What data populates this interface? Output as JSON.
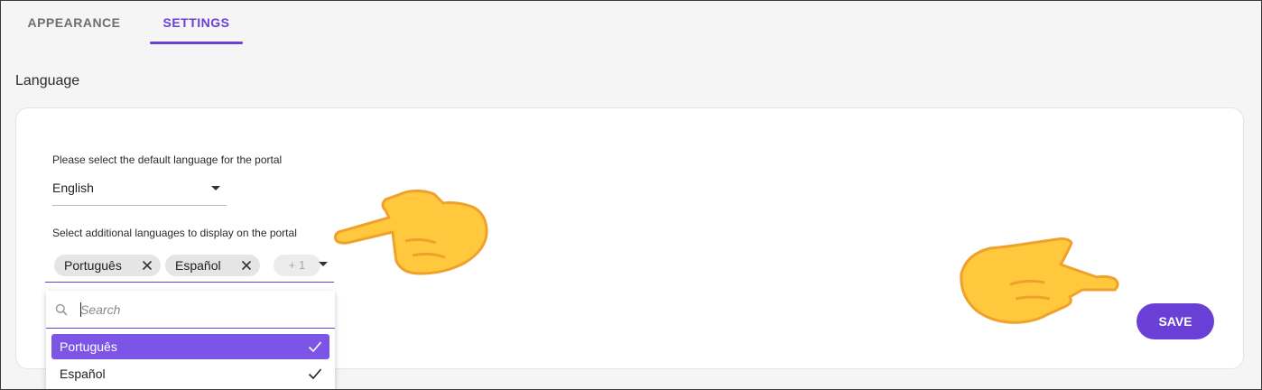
{
  "tabs": [
    {
      "label": "APPEARANCE",
      "active": false
    },
    {
      "label": "SETTINGS",
      "active": true
    }
  ],
  "section": {
    "title": "Language"
  },
  "default_language": {
    "label": "Please select the default language for the portal",
    "value": "English"
  },
  "additional_languages": {
    "label": "Select additional languages to display on the portal",
    "chips": [
      "Português",
      "Español"
    ],
    "more_count": "+ 1"
  },
  "dropdown": {
    "search_placeholder": "Search",
    "options": [
      {
        "label": "Português",
        "selected": true,
        "highlighted": true
      },
      {
        "label": "Español",
        "selected": true,
        "highlighted": false
      }
    ]
  },
  "actions": {
    "save_label": "SAVE"
  },
  "colors": {
    "accent": "#6a3fd6",
    "highlight": "#7d55e6",
    "hand": "#ffc83d"
  },
  "icons": [
    "search-icon",
    "close-icon",
    "check-icon",
    "chevron-down-icon",
    "pointing-hand-icon"
  ]
}
